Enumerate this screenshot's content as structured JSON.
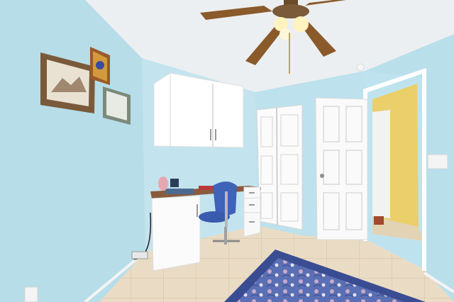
{
  "scene": {
    "description_label": "",
    "colors": {
      "wall": "#bfe3ee",
      "ceiling": "#eef0f2",
      "floor": "#ecdcc2",
      "cabinet": "#ffffff",
      "desk_top": "#8a5a3c",
      "chair": "#3f63b8",
      "rug": "#4a5fa6",
      "hall_wall": "#e9cf6a",
      "fan_blade": "#8a5a2b"
    },
    "objects": [
      "ceiling-fan",
      "wall-cabinet",
      "desk",
      "office-chair",
      "closet-bifold-doors",
      "open-door",
      "hallway",
      "area-rug",
      "framed-pictures",
      "tile-floor"
    ]
  }
}
